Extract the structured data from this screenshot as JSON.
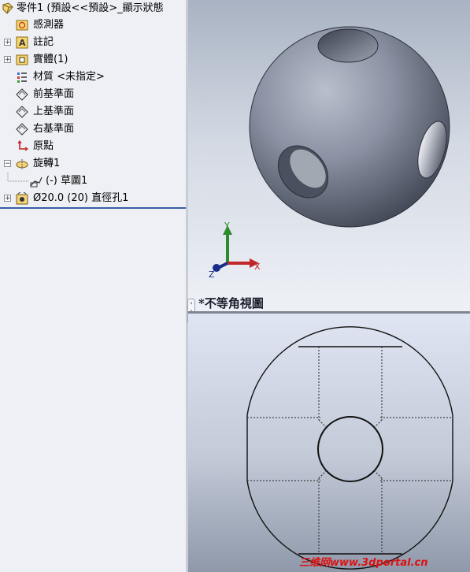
{
  "tree": {
    "root_label": "零件1  (預設<<預設>_顯示狀態",
    "items": [
      {
        "label": "感測器",
        "icon": "sensor-icon",
        "expandable": false
      },
      {
        "label": "註記",
        "icon": "annotation-icon",
        "expandable": true
      },
      {
        "label": "實體(1)",
        "icon": "solid-body-folder-icon",
        "expandable": true
      },
      {
        "label": "材質 <未指定>",
        "icon": "material-icon",
        "expandable": false
      },
      {
        "label": "前基準面",
        "icon": "plane-icon",
        "expandable": false
      },
      {
        "label": "上基準面",
        "icon": "plane-icon",
        "expandable": false
      },
      {
        "label": "右基準面",
        "icon": "plane-icon",
        "expandable": false
      },
      {
        "label": "原點",
        "icon": "origin-icon",
        "expandable": false
      },
      {
        "label": "旋轉1",
        "icon": "revolve-icon",
        "expandable": true,
        "expanded": true
      },
      {
        "label": "(-) 草圖1",
        "icon": "sketch-icon",
        "expandable": false,
        "child": true
      },
      {
        "label": "Ø20.0 (20) 直徑孔1",
        "icon": "hole-wizard-icon",
        "expandable": true
      }
    ]
  },
  "top_view": {
    "view_name": "*不等角視圖",
    "triad": {
      "x": "X",
      "y": "Y",
      "z": "Z"
    }
  },
  "watermark": "三维网www.3dportal.cn"
}
